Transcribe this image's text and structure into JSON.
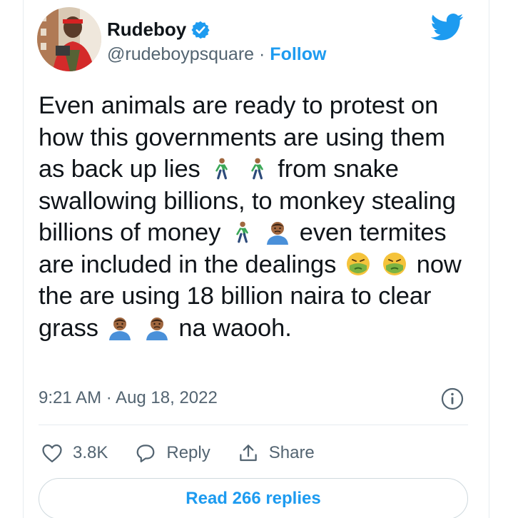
{
  "tweet": {
    "author": {
      "name": "Rudeboy",
      "handle": "@rudeboypsquare",
      "separator": " · ",
      "follow_label": "Follow",
      "verified": true
    },
    "text_parts": {
      "p1": "Even animals are ready to protest on how this governments are using them as back up lies",
      "p2": "from snake swallowing billions, to monkey stealing billions of money",
      "p3": "even termites are included in the dealings",
      "p4": "now the are using 18 billion naira to clear grass",
      "p5": "na waooh."
    },
    "emojis": [
      "person-walking",
      "person-walking",
      "person-walking",
      "person-pouting",
      "nauseated-face",
      "nauseated-face",
      "person-pouting",
      "person-pouting"
    ],
    "timestamp": "9:21 AM · Aug 18, 2022",
    "actions": {
      "likes": "3.8K",
      "reply_label": "Reply",
      "share_label": "Share"
    },
    "read_replies_label": "Read 266 replies"
  },
  "colors": {
    "accent": "#1d9bf0",
    "text": "#0f1419",
    "muted": "#536471",
    "border": "#e6ecf0"
  }
}
